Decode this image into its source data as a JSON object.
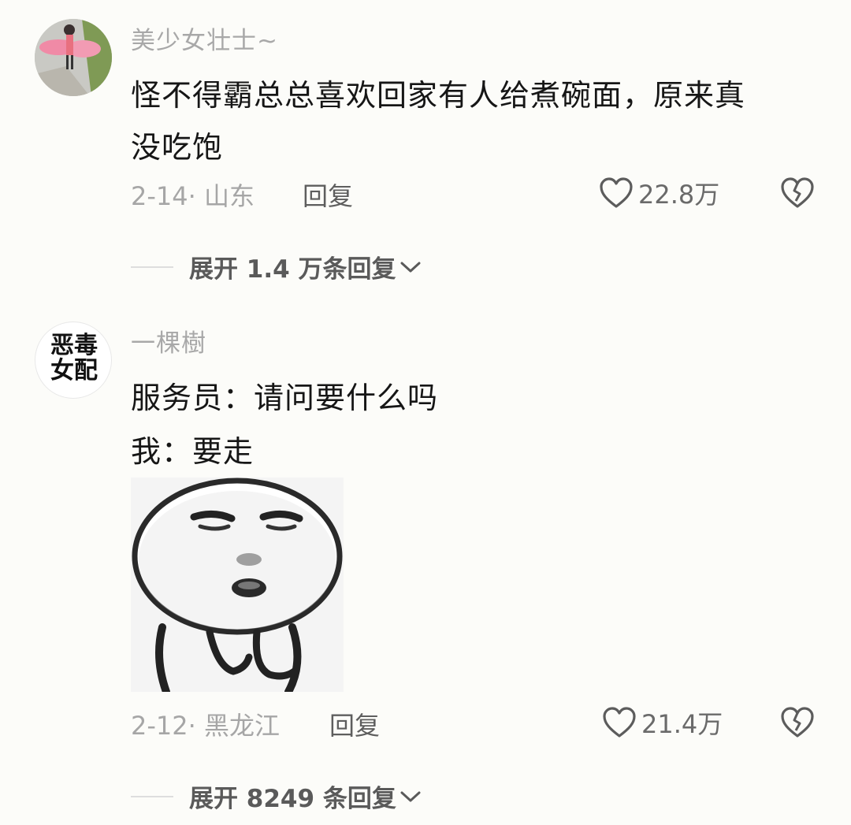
{
  "comments": [
    {
      "username": "美少女壮士~",
      "text_lines": [
        "怪不得霸总总喜欢回家有人给煮碗面，原来真",
        "没吃饱"
      ],
      "date_location": "2-14· 山东",
      "reply_label": "回复",
      "likes": "22.8万",
      "expand_label": "展开 1.4 万条回复",
      "avatar": "pink-figure-photo"
    },
    {
      "username": "一棵樹",
      "avatar_text_line1": "恶毒",
      "avatar_text_line2": "女配",
      "text_lines": [
        "服务员：请问要什么吗",
        "我：要走"
      ],
      "sticker": "meme-face-sticker",
      "date_location": "2-12· 黑龙江",
      "reply_label": "回复",
      "likes": "21.4万",
      "expand_label": "展开 8249 条回复"
    }
  ],
  "colors": {
    "background": "#fcfcf9",
    "text": "#161616",
    "muted": "#a6a6a6"
  }
}
